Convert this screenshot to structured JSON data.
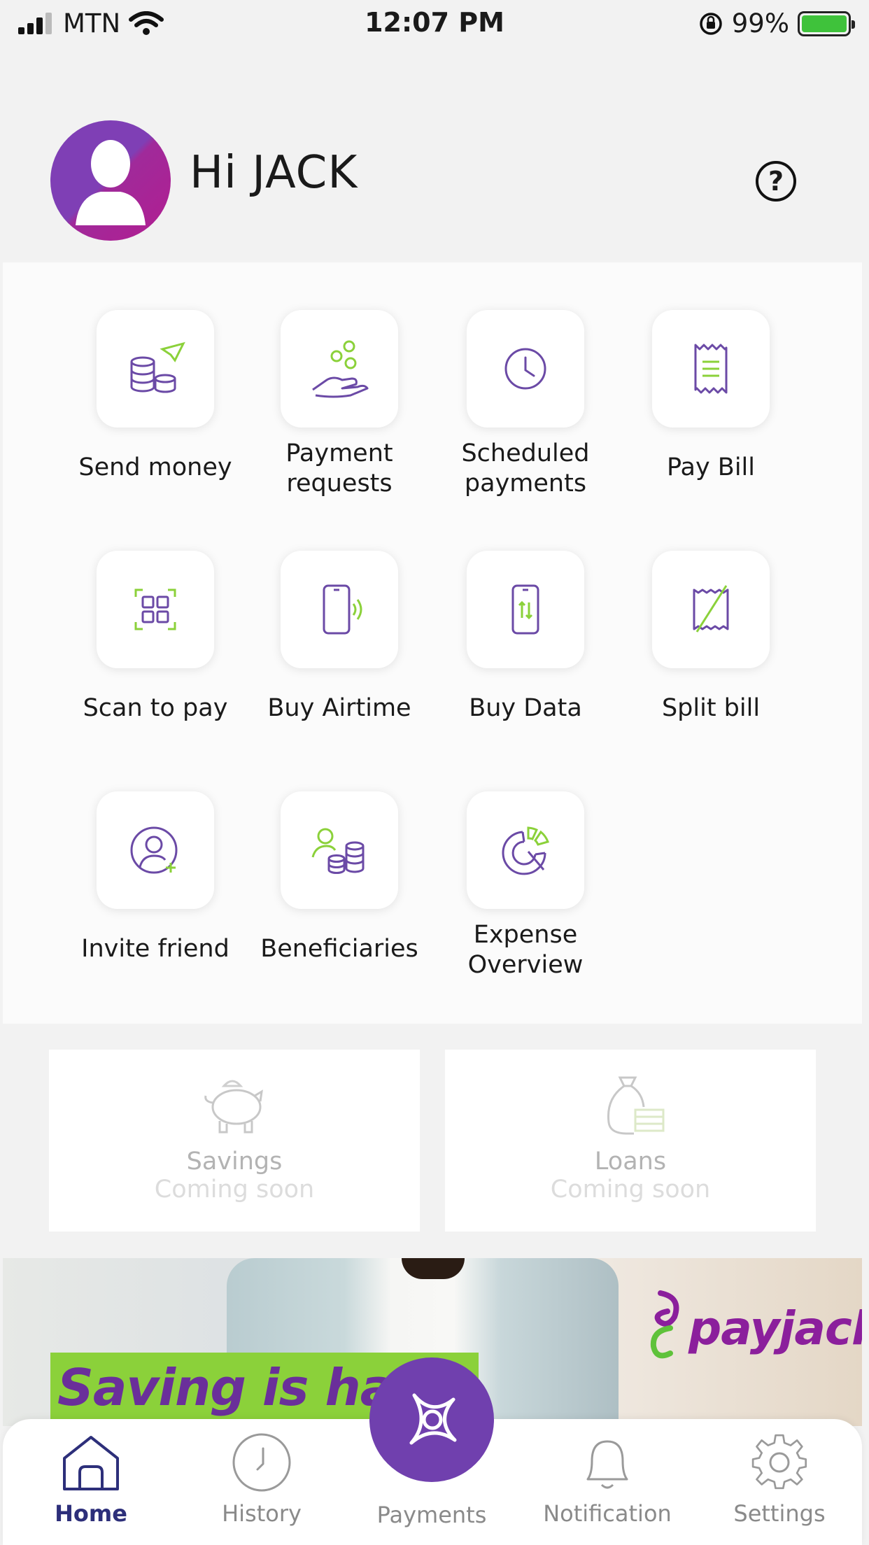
{
  "status_bar": {
    "carrier": "MTN",
    "time": "12:07 PM",
    "battery": "99%"
  },
  "header": {
    "greeting": "Hi JACK",
    "help_icon": "?"
  },
  "actions": [
    {
      "label": "Send money",
      "icon": "coins-send-icon"
    },
    {
      "label": "Payment\nrequests",
      "icon": "hand-coins-icon"
    },
    {
      "label": "Scheduled\npayments",
      "icon": "clock-icon"
    },
    {
      "label": "Pay Bill",
      "icon": "receipt-icon"
    },
    {
      "label": "Scan to pay",
      "icon": "qr-scan-icon"
    },
    {
      "label": "Buy Airtime",
      "icon": "phone-signal-icon"
    },
    {
      "label": "Buy Data",
      "icon": "phone-data-icon"
    },
    {
      "label": "Split bill",
      "icon": "split-receipt-icon"
    },
    {
      "label": "Invite friend",
      "icon": "user-add-icon"
    },
    {
      "label": "Beneficiaries",
      "icon": "user-coins-icon"
    },
    {
      "label": "Expense\nOverview",
      "icon": "pie-chart-icon"
    }
  ],
  "coming_soon": [
    {
      "title": "Savings",
      "subtitle": "Coming soon",
      "icon": "piggy-bank-icon"
    },
    {
      "title": "Loans",
      "subtitle": "Coming soon",
      "icon": "money-bag-icon"
    }
  ],
  "banner": {
    "headline": "Saving is hard,",
    "brand": "payjack"
  },
  "bottom_nav": {
    "home": "Home",
    "history": "History",
    "payments": "Payments",
    "notification": "Notification",
    "settings": "Settings"
  },
  "colors": {
    "accent": "#7040ae",
    "icon_purple": "#6b4aa6",
    "icon_green": "#8bd13a"
  }
}
